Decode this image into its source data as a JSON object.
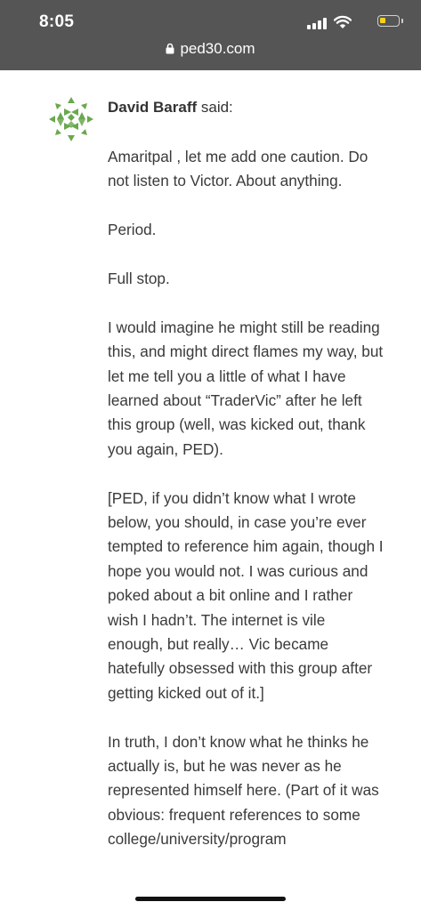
{
  "status_bar": {
    "time": "8:05",
    "url": "ped30.com",
    "icons": [
      "signal-icon",
      "wifi-icon",
      "battery-icon",
      "lock-icon"
    ]
  },
  "comment": {
    "author": "David Baraff",
    "said_suffix": " said:",
    "paragraphs": [
      "Amaritpal , let me add one caution. Do not listen to Victor. About anything.",
      "Period.",
      "Full stop.",
      "I would imagine he might still be reading this, and might direct flames my way, but let me tell you a little of what I have learned about “TraderVic” after he left this group (well, was kicked out, thank you again, PED).",
      "[PED, if you didn’t know what I wrote below, you should, in case you’re ever tempted to reference him again, though I hope you would not. I was curious and poked about a bit online and I rather wish I hadn’t. The internet is vile enough, but really… Vic became hatefully obsessed with this group after getting kicked out of it.]",
      "In truth, I don’t know what he thinks he actually is, but he was never as he represented himself here. (Part of it was obvious: frequent references to some college/university/program"
    ]
  },
  "colors": {
    "topbar_bg": "#555555",
    "text": "#3a3a3a",
    "avatar_green": "#6aa84f"
  }
}
